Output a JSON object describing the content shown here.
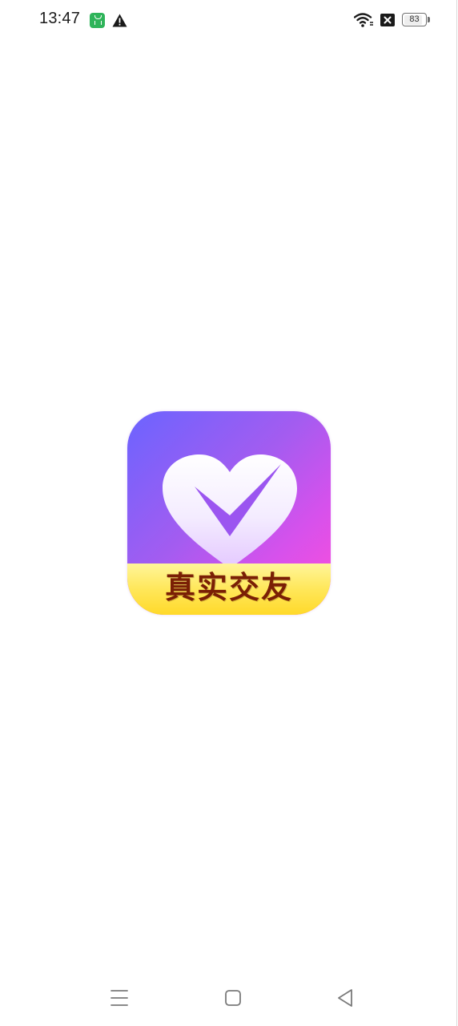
{
  "status_bar": {
    "time": "13:47",
    "battery_level": "83",
    "icons": [
      "app-notification-icon",
      "warning-icon",
      "wifi-icon",
      "no-sim-icon",
      "battery-icon"
    ]
  },
  "splash": {
    "logo_text": "真实交友",
    "colors": {
      "gradient_start": "#6b64ff",
      "gradient_mid": "#a45cf0",
      "gradient_end": "#ff4fd9",
      "banner_yellow": "#ffe75a",
      "text_brown": "#7a1f05"
    }
  },
  "nav_bar": {
    "icons": [
      "recent-apps-icon",
      "home-icon",
      "back-icon"
    ]
  }
}
